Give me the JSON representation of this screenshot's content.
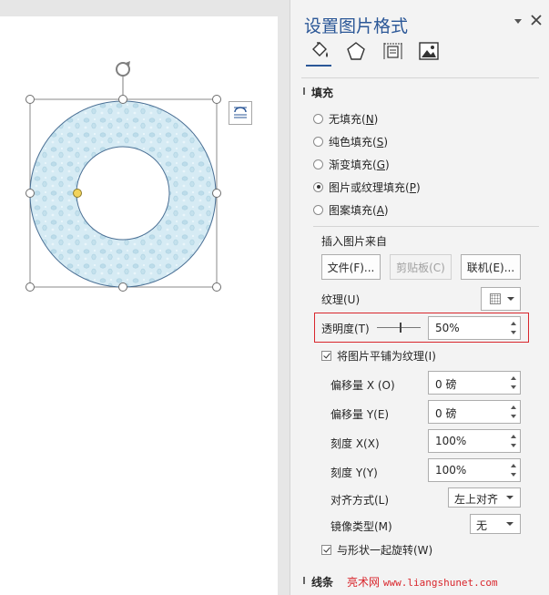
{
  "pane": {
    "title": "设置图片格式",
    "tabs": [
      "fill-line-icon",
      "effects-icon",
      "size-properties-icon",
      "picture-icon"
    ],
    "fill_section": {
      "header": "填充",
      "options": [
        {
          "text": "无填充(",
          "key": "N",
          "tail": ")",
          "checked": false
        },
        {
          "text": "纯色填充(",
          "key": "S",
          "tail": ")",
          "checked": false
        },
        {
          "text": "渐变填充(",
          "key": "G",
          "tail": ")",
          "checked": false
        },
        {
          "text": "图片或纹理填充(",
          "key": "P",
          "tail": ")",
          "checked": true
        },
        {
          "text": "图案填充(",
          "key": "A",
          "tail": ")",
          "checked": false
        }
      ],
      "insert_from": "插入图片来自",
      "file_button": "文件(F)...",
      "clipboard_button": "剪贴板(C)",
      "online_button": "联机(E)...",
      "texture_label": "纹理(U)",
      "transparency_label": "透明度(T)",
      "transparency_value": "50%",
      "transparency_level": 50,
      "tile_checkbox": {
        "label": "将图片平铺为纹理(I)",
        "checked": true
      },
      "offset_x": {
        "label": "偏移量 X (O)",
        "value": "0 磅"
      },
      "offset_y": {
        "label": "偏移量 Y(E)",
        "value": "0 磅"
      },
      "scale_x": {
        "label": "刻度 X(X)",
        "value": "100%"
      },
      "scale_y": {
        "label": "刻度 Y(Y)",
        "value": "100%"
      },
      "alignment": {
        "label": "对齐方式(L)",
        "value": "左上对齐"
      },
      "mirror": {
        "label": "镜像类型(M)",
        "value": "无"
      },
      "rotate_checkbox": {
        "label": "与形状一起旋转(W)",
        "checked": true
      }
    },
    "lines_section": {
      "header": "线条"
    }
  },
  "watermark": {
    "brand": "亮术网",
    "url": "www.liangshunet.com"
  },
  "colors": {
    "accent": "#2b5797",
    "highlight": "#d9262c",
    "shape_fill": "#cfe8f3",
    "shape_stroke": "#4a6f94"
  }
}
